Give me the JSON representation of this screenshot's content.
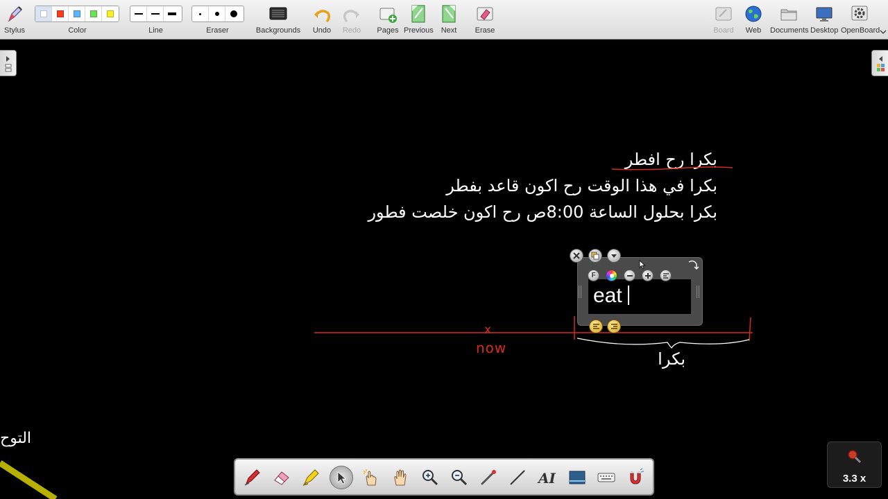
{
  "toolbar": {
    "stylus": "Stylus",
    "color": "Color",
    "line": "Line",
    "eraser": "Eraser",
    "backgrounds": "Backgrounds",
    "undo": "Undo",
    "redo": "Redo",
    "pages": "Pages",
    "previous": "Previous",
    "next": "Next",
    "erase": "Erase",
    "board": "Board",
    "web": "Web",
    "documents": "Documents",
    "desktop": "Desktop",
    "openboard": "OpenBoard",
    "colors": [
      "#ffffff",
      "#ff3b1f",
      "#5ab4ff",
      "#6fe05a",
      "#ffee2a"
    ]
  },
  "board": {
    "line1": "بكرا رح افطر",
    "line2": "بكرا في هذا الوقت رح اكون قاعد بفطر",
    "line3": "بكرا بحلول الساعة 8:00ص رح اكون خلصت فطور",
    "tomorrow_label": "بكرا",
    "now_label": "now",
    "x_mark": "x",
    "corner_text": "التوح"
  },
  "text_widget": {
    "content": "eat",
    "font_button": "F"
  },
  "zoom": {
    "label": "3.3 x"
  },
  "colors": {
    "timeline": "#d62a1f",
    "board_text": "#ffffff",
    "background": "#000000",
    "highlighter": "#b8b000"
  }
}
